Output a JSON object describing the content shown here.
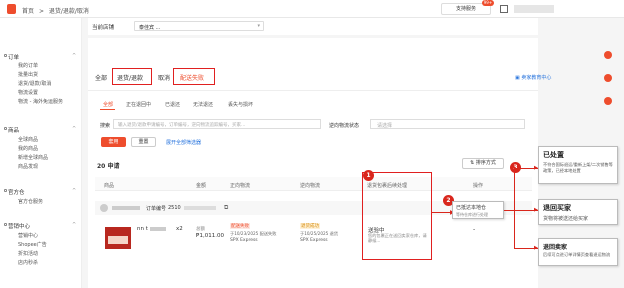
{
  "breadcrumb": {
    "home": "首页",
    "sep": ">",
    "current": "退货/退款/取消"
  },
  "topbar": {
    "support_label": "支持服务",
    "badge": "99+"
  },
  "sidebar": {
    "sections": [
      {
        "title": "订单",
        "items": [
          "我的订单",
          "批量出货",
          "退货/退款/取消",
          "物流设置",
          "物流 - 海外免运服务"
        ]
      },
      {
        "title": "商品",
        "items": [
          "全球商品",
          "我的商品",
          "新增全球商品",
          "商品发现"
        ]
      },
      {
        "title": "官方仓",
        "items": [
          "官方仓服务"
        ]
      },
      {
        "title": "营销中心",
        "items": [
          "营销中心",
          "Shopee广告",
          "折扣活动",
          "店内秒杀"
        ]
      }
    ]
  },
  "shop_row": {
    "label": "当前店铺",
    "value": "泰佳宾 ..."
  },
  "top_tabs": {
    "all": "全部",
    "refund": "退货/退款",
    "cancel": "取消",
    "failed": "配送失败",
    "help": "卖家教育中心"
  },
  "sub_tabs": [
    "全部",
    "正在退回中",
    "已退还",
    "无法退还",
    "丢失与损坏"
  ],
  "search": {
    "label": "搜索",
    "placeholder": "输入退货/退款申请编号，订单编号，逆向物流追踪编号，买家...",
    "logistics_label": "逆向物流状态",
    "logistics_placeholder": "请选择"
  },
  "filter_buttons": {
    "apply": "套用",
    "reset": "重置",
    "expand": "展开全部筛选器"
  },
  "count_label": "20 申请",
  "sort_label": "排序方式",
  "table": {
    "headers": [
      "商品",
      "金额",
      "正向物流",
      "逆向物流",
      "退货包裹后续处理",
      "操作"
    ],
    "order_label": "订单编号",
    "order_no": "2510",
    "row": {
      "product": "nn t",
      "qty": "x2",
      "amount_label": "总额",
      "amount": "₱1,011.00",
      "forward_status": "配送失败",
      "forward_date": "于10/23/2025 配送失败",
      "forward_carrier": "SPX Express",
      "reverse_status": "退货成功",
      "reverse_date": "于10/25/2025 退货",
      "reverse_carrier": "SPX Express",
      "handling_status": "送验中",
      "handling_desc": "您的包裹正在送回卖家仓库，请静候...",
      "action": "-"
    }
  },
  "annotations": {
    "n1": "1",
    "n2": "2",
    "n3": "3",
    "box2_title": "已抵达本地仓",
    "box2_desc": "等待仓库进行处理",
    "box_a_title": "已处置",
    "box_a_desc": "不符合国际退运/重新上架/二次销售等政策，已经本地处置",
    "box_b_title": "退回买家",
    "box_b_desc": "货物将被送还给买家",
    "box_c_title": "退回卖家",
    "box_c_desc": "后续可点进订单详情页查看退运物流"
  },
  "colors": {
    "accent": "#ee4d2d",
    "annotation_red": "#d9261c",
    "link_blue": "#2673dd"
  }
}
